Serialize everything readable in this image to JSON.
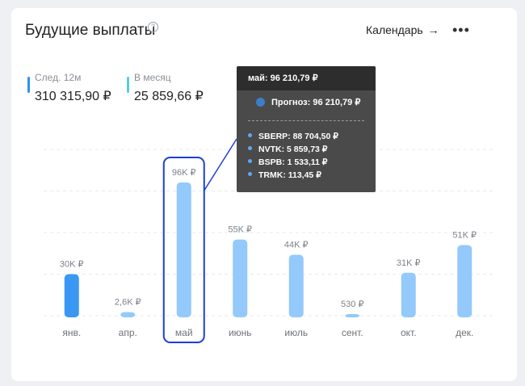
{
  "header": {
    "title": "Будущие выплаты",
    "help_icon": "?",
    "calendar_label": "Календарь",
    "arrow_icon": "arrow-right-icon",
    "more_icon": "more-icon"
  },
  "stats": [
    {
      "label": "След. 12м",
      "value": "310 315,90 ₽",
      "color": "#2f8ff2"
    },
    {
      "label": "В месяц",
      "value": "25 859,66 ₽",
      "color": "#5bc8e8"
    }
  ],
  "chart_data": {
    "type": "bar",
    "categories": [
      "янв.",
      "апр.",
      "май",
      "июнь",
      "июль",
      "сент.",
      "окт.",
      "дек."
    ],
    "values": [
      30000,
      2600,
      96210.79,
      55000,
      44000,
      530,
      31000,
      51000
    ],
    "data_labels": [
      "30K ₽",
      "2,6K ₽",
      "96K ₽",
      "55K ₽",
      "44K ₽",
      "530 ₽",
      "31K ₽",
      "51K ₽"
    ],
    "bar_colors": [
      "#3a97f4",
      "#93c9fb",
      "#93c9fb",
      "#93c9fb",
      "#93c9fb",
      "#93c9fb",
      "#93c9fb",
      "#93c9fb"
    ],
    "highlighted_category": "май",
    "ylim": [
      0,
      120000
    ],
    "grid": true,
    "title": "",
    "xlabel": "",
    "ylabel": ""
  },
  "tooltip": {
    "title": "май: 96 210,79 ₽",
    "forecast": "Прогноз: 96 210,79 ₽",
    "items": [
      "SBERP: 88 704,50 ₽",
      "NVTK: 5 859,73 ₽",
      "BSPB: 1 533,11 ₽",
      "TRMK: 113,45 ₽"
    ]
  }
}
